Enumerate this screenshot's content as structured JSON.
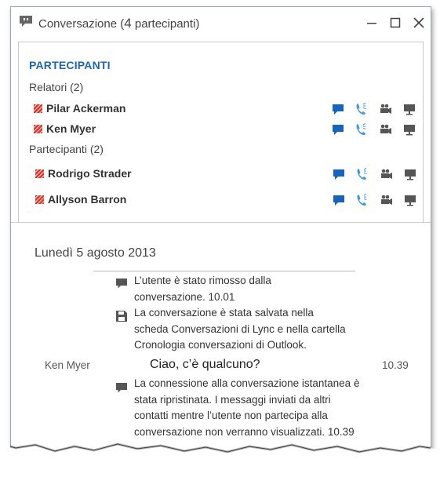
{
  "window": {
    "title_prefix": "Conversazione (",
    "title_count": "4",
    "title_suffix": " partecipanti)"
  },
  "participants": {
    "heading": "PARTECIPANTI",
    "groups": [
      {
        "label": "Relatori (2)",
        "people": [
          {
            "name": "Pilar Ackerman"
          },
          {
            "name": "Ken Myer"
          }
        ]
      },
      {
        "label": "Partecipanti (2)",
        "people": [
          {
            "name": "Rodrigo Strader"
          },
          {
            "name": "Allyson Barron"
          }
        ]
      }
    ],
    "action_icons": [
      "chat-icon",
      "phone-icon",
      "video-camera-icon",
      "presentation-icon"
    ]
  },
  "conversation": {
    "date": "Lunedì 5 agosto 2013",
    "entries": [
      {
        "type": "system",
        "icon": "chat-bubble-icon",
        "lines": [
          "L’utente è stato rimosso dalla",
          "conversazione. 10.01"
        ]
      },
      {
        "type": "system",
        "icon": "save-icon",
        "lines": [
          "La conversazione è stata salvata nella",
          "scheda Conversazioni di Lync e nella cartella",
          "Cronologia conversazioni di Outlook."
        ]
      },
      {
        "type": "message",
        "sender": "Ken Myer",
        "text": "Ciao, c’è qualcuno?",
        "time": "10.39"
      },
      {
        "type": "system",
        "icon": "chat-bubble-icon",
        "lines": [
          "La connessione alla conversazione istantanea è",
          "stata ripristinata. I messaggi inviati da altri",
          "contatti mentre l’utente non partecipa alla",
          "conversazione non verranno visualizzati. 10.39"
        ]
      }
    ]
  },
  "colors": {
    "accent_blue": "#1a66b8",
    "icon_blue": "#1565c0",
    "phone_blue": "#3a9be0",
    "presence_red": "#d9342b",
    "icon_gray": "#555555"
  }
}
